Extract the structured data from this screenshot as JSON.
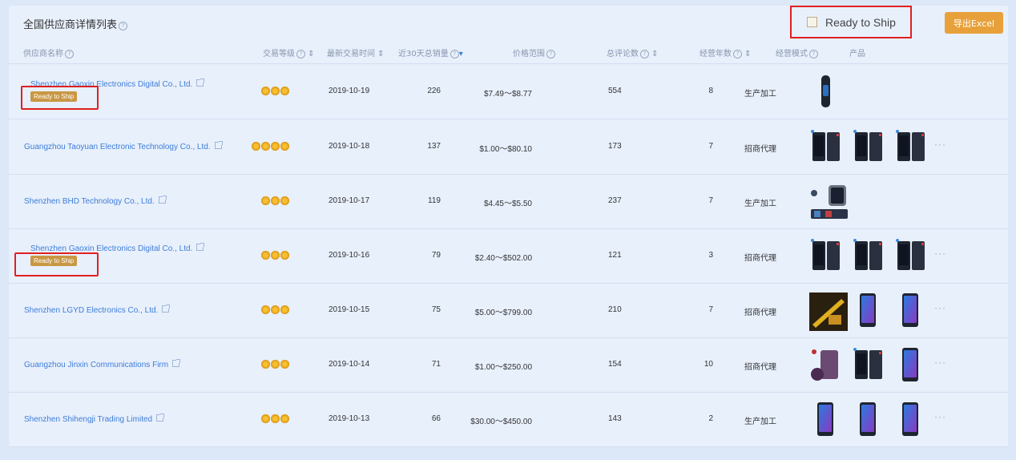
{
  "page": {
    "title": "全国供应商详情列表",
    "ready_to_ship_toggle": "Ready to Ship",
    "export_button": "导出Excel"
  },
  "table": {
    "columns": [
      "供应商名称",
      "交易等级",
      "最新交易时间",
      "近30天总销量",
      "价格范围",
      "总评论数",
      "经营年数",
      "经营模式",
      "产品"
    ],
    "rows": [
      {
        "supplier": "Shenzhen Gaoxin Electronics Digital Co., Ltd.",
        "badge": "Ready to Ship",
        "stars": 3,
        "date": "2019-10-19",
        "sales": "226",
        "price": "$7.49～$8.77",
        "reviews": "554",
        "years": "8",
        "mode": "生产加工",
        "thumbs": [
          "smart-band"
        ],
        "more": false
      },
      {
        "supplier": "Guangzhou Taoyuan Electronic Technology Co., Ltd.",
        "badge": "",
        "stars": 4,
        "date": "2019-10-18",
        "sales": "137",
        "price": "$1.00～$80.10",
        "reviews": "173",
        "years": "7",
        "mode": "招商代理",
        "thumbs": [
          "phone-screen",
          "phone-screen",
          "phone-screen"
        ],
        "more": true
      },
      {
        "supplier": "Shenzhen BHD Technology Co., Ltd.",
        "badge": "",
        "stars": 3,
        "date": "2019-10-17",
        "sales": "119",
        "price": "$4.45～$5.50",
        "reviews": "237",
        "years": "7",
        "mode": "生产加工",
        "thumbs": [
          "smart-watch"
        ],
        "more": false
      },
      {
        "supplier": "Shenzhen Gaoxin Electronics Digital Co., Ltd.",
        "badge": "Ready to Ship",
        "stars": 3,
        "date": "2019-10-16",
        "sales": "79",
        "price": "$2.40～$502.00",
        "reviews": "121",
        "years": "3",
        "mode": "招商代理",
        "thumbs": [
          "phone-screen",
          "phone-screen",
          "phone-screen"
        ],
        "more": true
      },
      {
        "supplier": "Shenzhen LGYD Electronics Co., Ltd.",
        "badge": "",
        "stars": 3,
        "date": "2019-10-15",
        "sales": "75",
        "price": "$5.00～$799.00",
        "reviews": "210",
        "years": "7",
        "mode": "招商代理",
        "thumbs": [
          "phone-box",
          "phone",
          "phone"
        ],
        "more": true
      },
      {
        "supplier": "Guangzhou Jinxin Communications Firm",
        "badge": "",
        "stars": 3,
        "date": "2019-10-14",
        "sales": "71",
        "price": "$1.00～$250.00",
        "reviews": "154",
        "years": "10",
        "mode": "招商代理",
        "thumbs": [
          "phone-parts",
          "phone-screen",
          "phone"
        ],
        "more": true
      },
      {
        "supplier": "Shenzhen Shihengji Trading Limited",
        "badge": "",
        "stars": 3,
        "date": "2019-10-13",
        "sales": "66",
        "price": "$30.00～$450.00",
        "reviews": "143",
        "years": "2",
        "mode": "生产加工",
        "thumbs": [
          "phone",
          "phone",
          "phone"
        ],
        "more": true
      }
    ]
  },
  "colors": {
    "accent": "#3d7dd8",
    "badge": "#c99744",
    "export": "#e8a13a",
    "highlight": "#e02020"
  }
}
